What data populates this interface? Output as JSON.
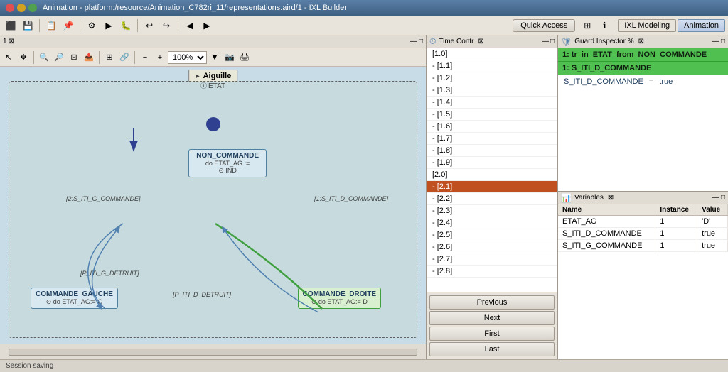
{
  "titlebar": {
    "title": "Animation - platform:/resource/Animation_C782ri_11/representations.aird/1 - IXL Builder"
  },
  "toolbar": {
    "quick_access_label": "Quick Access",
    "ixl_modeling_label": "IXL Modeling",
    "animation_label": "Animation"
  },
  "left_panel": {
    "title": "1",
    "tab_label": "",
    "diagram_title": "Aiguille",
    "state_container_label": "ETAT",
    "zoom_value": "100%",
    "nodes": [
      {
        "id": "non_commande",
        "label": "NON_COMMANDE",
        "action": "do ETAT_AG :=\nIND"
      },
      {
        "id": "commande_gauche",
        "label": "COMMANDE_GAUCHE",
        "action": "do ETAT_AG:= G"
      },
      {
        "id": "commande_droite",
        "label": "COMMANDE_DROITE",
        "action": "do ETAT_AG:= D"
      }
    ],
    "transitions": [
      {
        "label": "[2:S_ITI_G_COMMANDE]"
      },
      {
        "label": "[1:S_ITI_D_COMMANDE]"
      },
      {
        "label": "[P_ITI_G_DETRUIT]"
      },
      {
        "label": "[P_ITI_D_DETRUIT]"
      }
    ]
  },
  "time_controller": {
    "title": "Time Contr",
    "items": [
      "[1.0]",
      "- [1.1]",
      "- [1.2]",
      "- [1.3]",
      "- [1.4]",
      "- [1.5]",
      "- [1.6]",
      "- [1.7]",
      "- [1.8]",
      "- [1.9]",
      "[2.0]",
      "- [2.1]",
      "- [2.2]",
      "- [2.3]",
      "- [2.4]",
      "- [2.5]",
      "- [2.6]",
      "- [2.7]",
      "- [2.8]"
    ],
    "selected_index": 11,
    "buttons": {
      "previous": "Previous",
      "next": "Next",
      "first": "First",
      "last": "Last"
    }
  },
  "guard_inspector": {
    "title": "Guard Inspector %",
    "selected_row1": "1: tr_in_ETAT_from_NON_COMMANDE",
    "selected_row2": "1: S_ITI_D_COMMANDE",
    "variable": "S_ITI_D_COMMANDE",
    "equals": "=",
    "value": "true"
  },
  "variables": {
    "title": "Variables",
    "columns": [
      "Name",
      "Instance",
      "Value"
    ],
    "rows": [
      {
        "name": "ETAT_AG",
        "instance": "1",
        "value": "'D'"
      },
      {
        "name": "S_ITI_D_COMMANDE",
        "instance": "1",
        "value": "true"
      },
      {
        "name": "S_ITI_G_COMMANDE",
        "instance": "1",
        "value": "true"
      }
    ]
  },
  "status_bar": {
    "text": "Session saving"
  },
  "icons": {
    "clock": "⏱",
    "shield": "🛡",
    "variable": "📊",
    "gear": "⚙",
    "search": "🔍",
    "close": "✕",
    "min": "—",
    "max": "□",
    "restore": "❐"
  }
}
